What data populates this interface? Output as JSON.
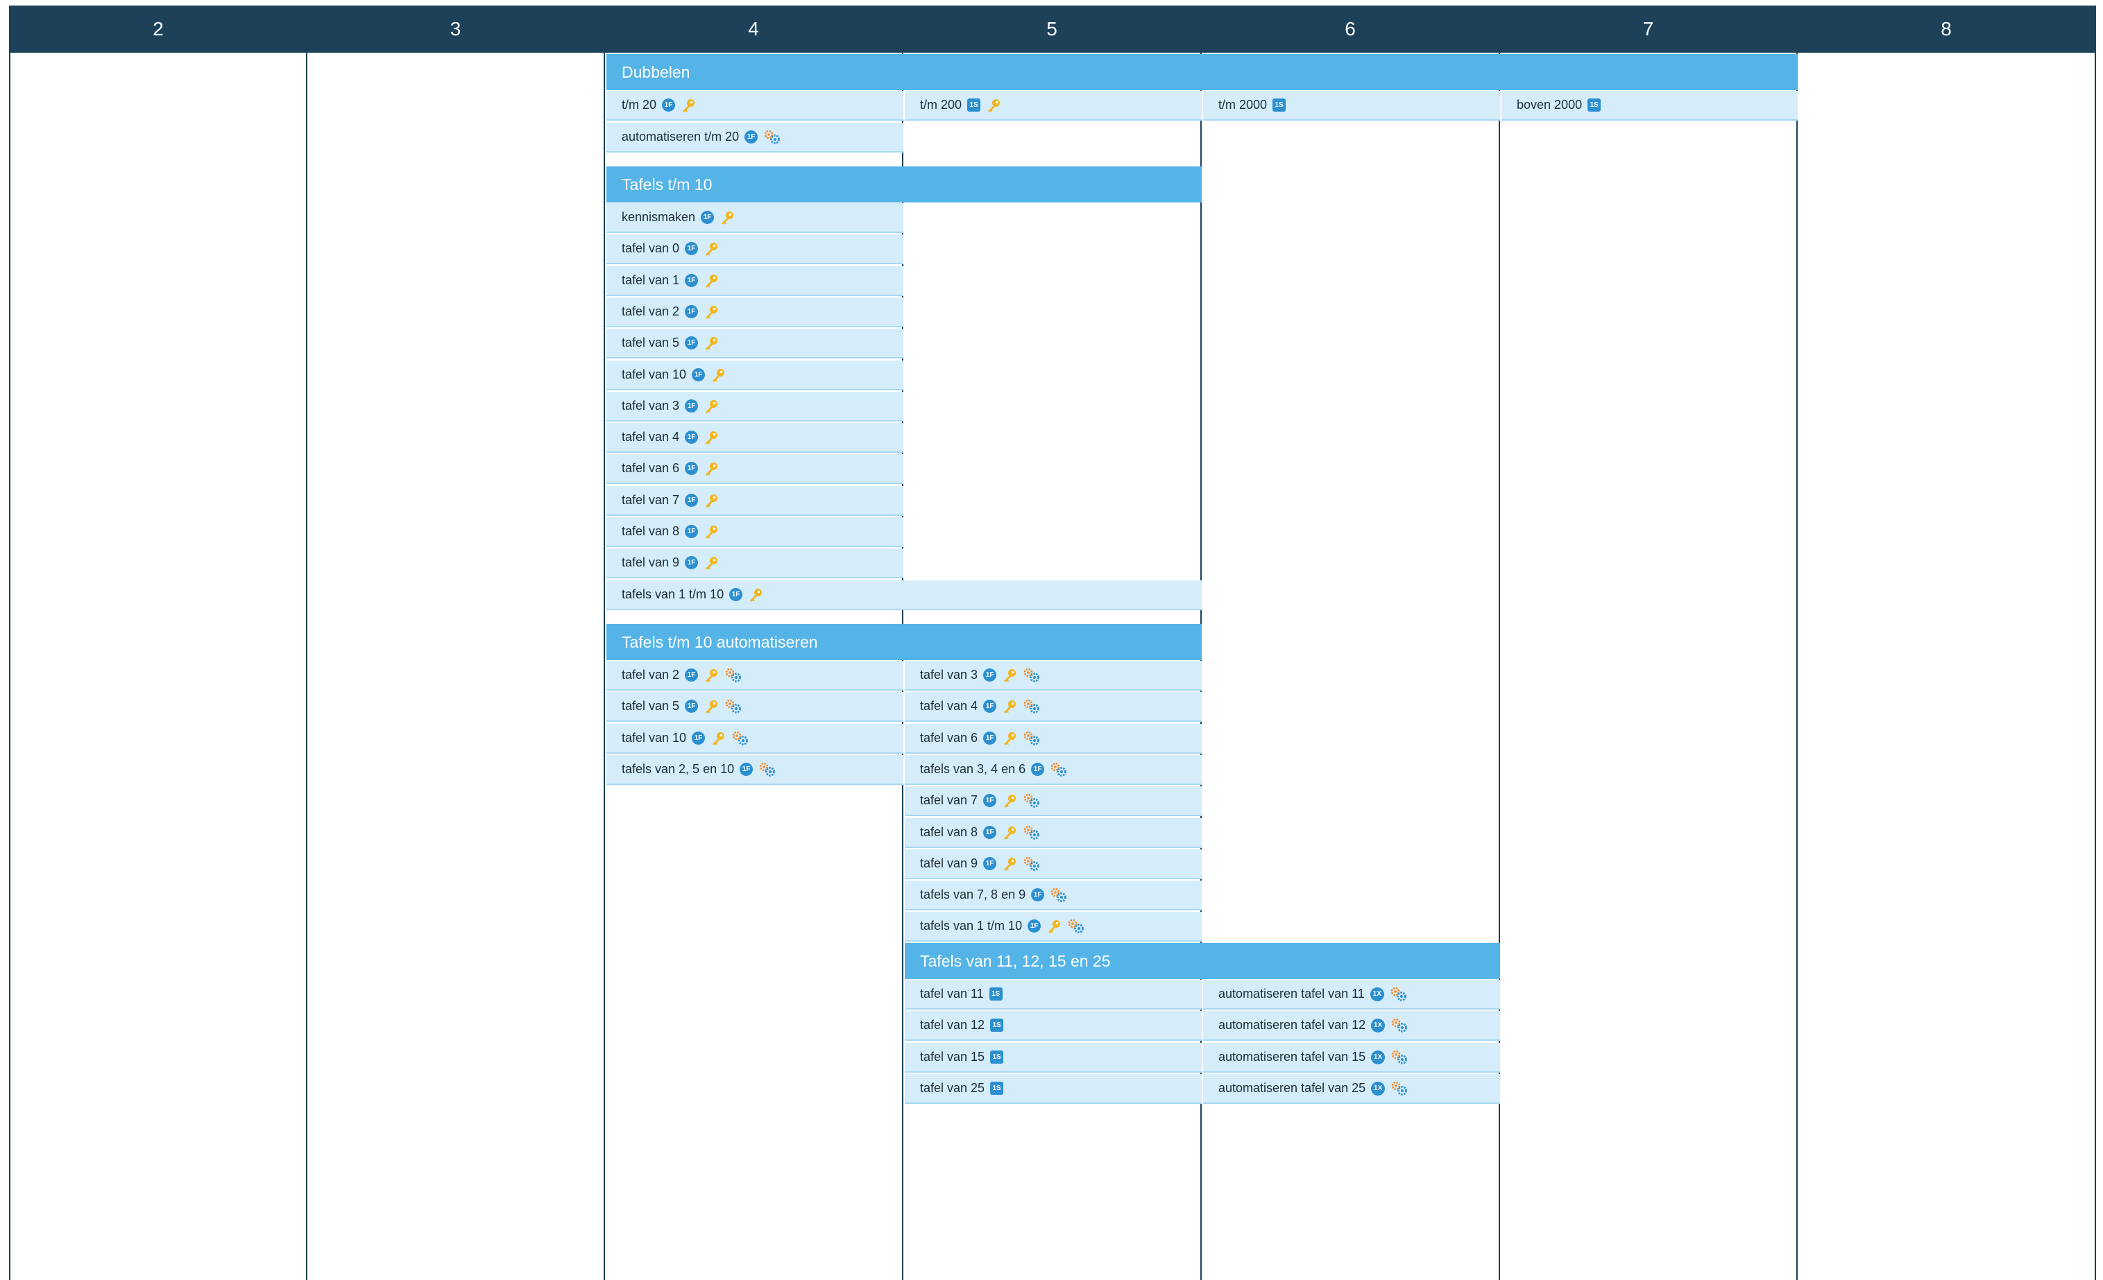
{
  "columns": [
    "2",
    "3",
    "4",
    "5",
    "6",
    "7",
    "8"
  ],
  "sections": {
    "dubbelen": {
      "title": "Dubbelen",
      "items": [
        {
          "label": "t/m 20",
          "icons": [
            "1f-circle-icon",
            "key-icon"
          ]
        },
        {
          "label": "automatiseren t/m 20",
          "icons": [
            "1f-circle-icon",
            "gears-icon"
          ]
        },
        {
          "label": "t/m 200",
          "icons": [
            "1s-square-icon",
            "key-icon"
          ]
        },
        {
          "label": "t/m 2000",
          "icons": [
            "1s-square-icon"
          ]
        },
        {
          "label": "boven 2000",
          "icons": [
            "1s-square-icon"
          ]
        }
      ]
    },
    "tafels10": {
      "title": "Tafels t/m 10",
      "items": [
        {
          "label": "kennismaken",
          "icons": [
            "1f-circle-icon",
            "key-icon"
          ]
        },
        {
          "label": "tafel van 0",
          "icons": [
            "1f-circle-icon",
            "key-icon"
          ]
        },
        {
          "label": "tafel van 1",
          "icons": [
            "1f-circle-icon",
            "key-icon"
          ]
        },
        {
          "label": "tafel van 2",
          "icons": [
            "1f-circle-icon",
            "key-icon"
          ]
        },
        {
          "label": "tafel van 5",
          "icons": [
            "1f-circle-icon",
            "key-icon"
          ]
        },
        {
          "label": "tafel van 10",
          "icons": [
            "1f-circle-icon",
            "key-icon"
          ]
        },
        {
          "label": "tafel van 3",
          "icons": [
            "1f-circle-icon",
            "key-icon"
          ]
        },
        {
          "label": "tafel van 4",
          "icons": [
            "1f-circle-icon",
            "key-icon"
          ]
        },
        {
          "label": "tafel van 6",
          "icons": [
            "1f-circle-icon",
            "key-icon"
          ]
        },
        {
          "label": "tafel van 7",
          "icons": [
            "1f-circle-icon",
            "key-icon"
          ]
        },
        {
          "label": "tafel van 8",
          "icons": [
            "1f-circle-icon",
            "key-icon"
          ]
        },
        {
          "label": "tafel van 9",
          "icons": [
            "1f-circle-icon",
            "key-icon"
          ]
        },
        {
          "label": "tafels van 1 t/m 10",
          "icons": [
            "1f-circle-icon",
            "key-icon"
          ]
        }
      ]
    },
    "tafels10auto": {
      "title": "Tafels t/m 10 automatiseren",
      "items": [
        {
          "label": "tafel van 2",
          "icons": [
            "1f-circle-icon",
            "key-icon",
            "gears-icon"
          ]
        },
        {
          "label": "tafel van 5",
          "icons": [
            "1f-circle-icon",
            "key-icon",
            "gears-icon"
          ]
        },
        {
          "label": "tafel van 10",
          "icons": [
            "1f-circle-icon",
            "key-icon",
            "gears-icon"
          ]
        },
        {
          "label": "tafels van 2, 5 en 10",
          "icons": [
            "1f-circle-icon",
            "gears-icon"
          ]
        },
        {
          "label": "tafel van 3",
          "icons": [
            "1f-circle-icon",
            "key-icon",
            "gears-icon"
          ]
        },
        {
          "label": "tafel van 4",
          "icons": [
            "1f-circle-icon",
            "key-icon",
            "gears-icon"
          ]
        },
        {
          "label": "tafel van 6",
          "icons": [
            "1f-circle-icon",
            "key-icon",
            "gears-icon"
          ]
        },
        {
          "label": "tafels van 3, 4 en 6",
          "icons": [
            "1f-circle-icon",
            "gears-icon"
          ]
        },
        {
          "label": "tafel van 7",
          "icons": [
            "1f-circle-icon",
            "key-icon",
            "gears-icon"
          ]
        },
        {
          "label": "tafel van 8",
          "icons": [
            "1f-circle-icon",
            "key-icon",
            "gears-icon"
          ]
        },
        {
          "label": "tafel van 9",
          "icons": [
            "1f-circle-icon",
            "key-icon",
            "gears-icon"
          ]
        },
        {
          "label": "tafels van 7, 8 en 9",
          "icons": [
            "1f-circle-icon",
            "gears-icon"
          ]
        },
        {
          "label": "tafels van 1 t/m 10",
          "icons": [
            "1f-circle-icon",
            "key-icon",
            "gears-icon"
          ]
        }
      ]
    },
    "tafels11": {
      "title": "Tafels van 11, 12, 15 en 25",
      "items": [
        {
          "label": "tafel van 11",
          "icons": [
            "1s-square-icon"
          ]
        },
        {
          "label": "tafel van 12",
          "icons": [
            "1s-square-icon"
          ]
        },
        {
          "label": "tafel van 15",
          "icons": [
            "1s-square-icon"
          ]
        },
        {
          "label": "tafel van 25",
          "icons": [
            "1s-square-icon"
          ]
        },
        {
          "label": "automatiseren tafel van 11",
          "icons": [
            "1x-badge-icon",
            "gears-icon"
          ]
        },
        {
          "label": "automatiseren tafel van 12",
          "icons": [
            "1x-badge-icon",
            "gears-icon"
          ]
        },
        {
          "label": "automatiseren tafel van 15",
          "icons": [
            "1x-badge-icon",
            "gears-icon"
          ]
        },
        {
          "label": "automatiseren tafel van 25",
          "icons": [
            "1x-badge-icon",
            "gears-icon"
          ]
        }
      ]
    }
  },
  "icon_text": {
    "circle": "1F",
    "square": "1S",
    "badge": "1X"
  },
  "colors": {
    "header": "#1c4159",
    "band": "#55b4e7",
    "item": "#d5edfa",
    "icon_blue": "#2b8fd0",
    "key": "#f2b51c",
    "gear_orange": "#f08a24"
  }
}
